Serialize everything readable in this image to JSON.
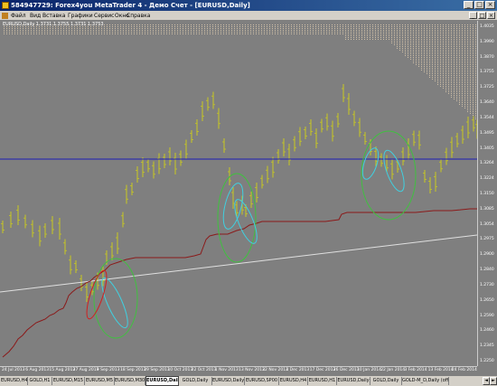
{
  "window": {
    "title": "584947729: Forex4you MetaTrader 4 - Демо Счет - [EURUSD,Daily]",
    "icon": "metatrader-icon",
    "buttons": [
      "_",
      "□",
      "×"
    ]
  },
  "menu": {
    "items": [
      "Файл",
      "Вид",
      "Вставка",
      "Графики",
      "Сервис",
      "Окно",
      "Справка"
    ],
    "mdi_buttons": [
      "_",
      "□",
      "×"
    ]
  },
  "chart": {
    "info_line": "EURUSD,Daily 1.3731 1.3755 1.3731 1.3753",
    "colors": {
      "background": "#7f7f7f",
      "candles": "#c8c820",
      "blue_line": "#1e1eb4",
      "white_line": "#e0e0e0",
      "red_line": "#8b1a1a",
      "ellipse_green": "#40c040",
      "ellipse_cyan": "#40d0e0",
      "ellipse_red": "#d02020",
      "dots_upper": "#d0c0a8"
    },
    "y_ticks": [
      "1.4035",
      "1.3990",
      "1.3870",
      "1.3755",
      "1.3725",
      "1.3640",
      "1.3544",
      "1.3495",
      "1.3405",
      "1.3264",
      "1.3224",
      "1.3150",
      "1.3085",
      "1.3054",
      "1.2975",
      "1.2900",
      "1.2840",
      "1.2730",
      "1.2650",
      "1.2590",
      "1.2460",
      "1.2345",
      "1.2250"
    ],
    "x_ticks": [
      "24 Jul 2013",
      "6 Aug 2013",
      "15 Aug 2013",
      "27 Aug 2013",
      "9 Sep 2013",
      "18 Sep 2013",
      "29 Sep 2013",
      "10 Oct 2013",
      "22 Oct 2013",
      "1 Nov 2013",
      "13 Nov 2013",
      "22 Nov 2013",
      "4 Dec 2013",
      "17 Dec 2013",
      "26 Dec 2013",
      "10 Jan 2014",
      "22 Jan 2014",
      "3 Feb 2014",
      "13 Feb 2014",
      "24 Feb 2014"
    ]
  },
  "tabs": {
    "items": [
      "EURUSD,H4",
      "GOLD,H1",
      "EURUSD,M15",
      "EURUSD,M5",
      "EURUSD,M30",
      "EURUSD,Daily",
      "GOLD,Daily",
      "EURUSD,Daily",
      "EURUSD,SP00",
      "EURUSD,H4",
      "EURUSD,H1",
      "EURUSD,Daily",
      "GOLD,Daily",
      "GOLD-M_D,Daily (offline)"
    ],
    "active_index": 5,
    "scroll": [
      "◄",
      "►"
    ]
  }
}
